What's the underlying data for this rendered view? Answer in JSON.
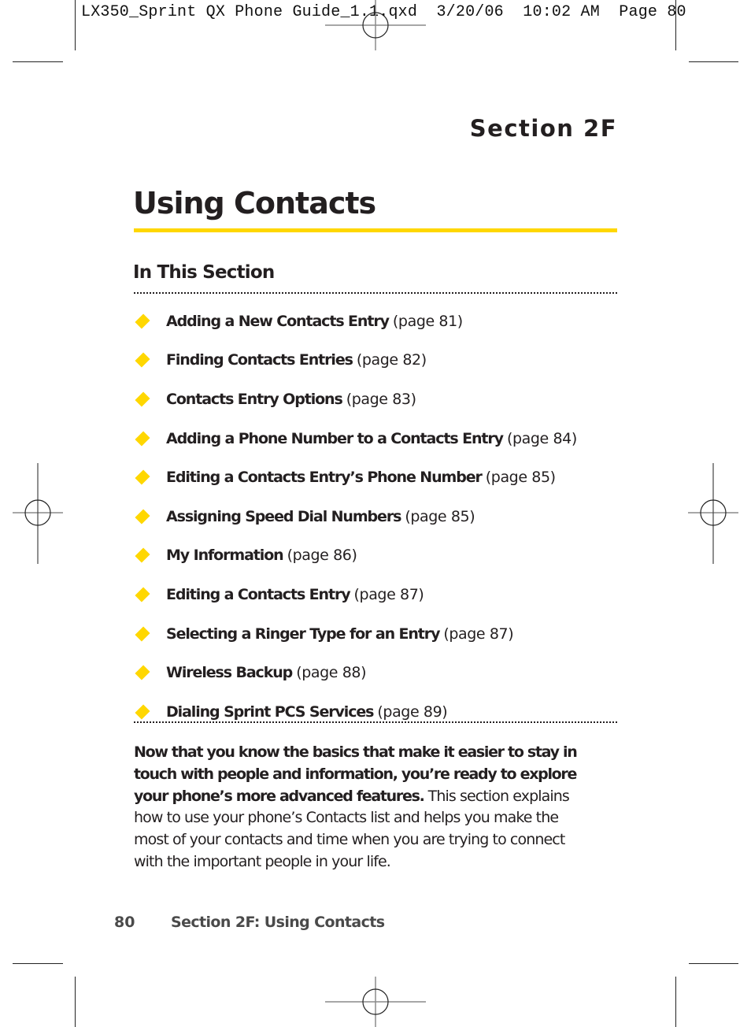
{
  "slug_line": "LX350_Sprint QX Phone Guide_1.1.qxd  3/20/06  10:02 AM  Page 80",
  "section_label": "Section 2F",
  "title": "Using Contacts",
  "accent_color": "#ffd700",
  "in_this_section": {
    "heading": "In This Section",
    "bullet_icon": "yellow-diamond",
    "items": [
      {
        "title": "Adding a New Contacts Entry",
        "page": "(page 81)"
      },
      {
        "title": "Finding Contacts Entries",
        "page": "(page 82)"
      },
      {
        "title": "Contacts Entry Options",
        "page": "(page 83)"
      },
      {
        "title": "Adding a Phone Number to a Contacts Entry",
        "page": "(page 84)"
      },
      {
        "title": "Editing a Contacts Entry’s Phone Number",
        "page": "(page 85)"
      },
      {
        "title": "Assigning Speed Dial Numbers",
        "page": "(page 85)"
      },
      {
        "title": "My Information",
        "page": "(page 86)"
      },
      {
        "title": "Editing a Contacts Entry",
        "page": "(page 87)"
      },
      {
        "title": "Selecting a Ringer Type for an  Entry",
        "page": "(page 87)"
      },
      {
        "title": "Wireless Backup",
        "page": "(page 88)"
      },
      {
        "title": "Dialing Sprint PCS Services",
        "page": "(page 89)"
      }
    ]
  },
  "intro": {
    "bold": "Now that you know the basics that make it easier to stay in touch with people and information, you’re ready to explore your phone’s more advanced features.",
    "regular": " This section explains how to use your phone’s Contacts list and helps you make the most of your contacts and time when you are trying to connect with the important people in your life."
  },
  "footer": {
    "page_number": "80",
    "running_title": "Section 2F: Using Contacts"
  }
}
